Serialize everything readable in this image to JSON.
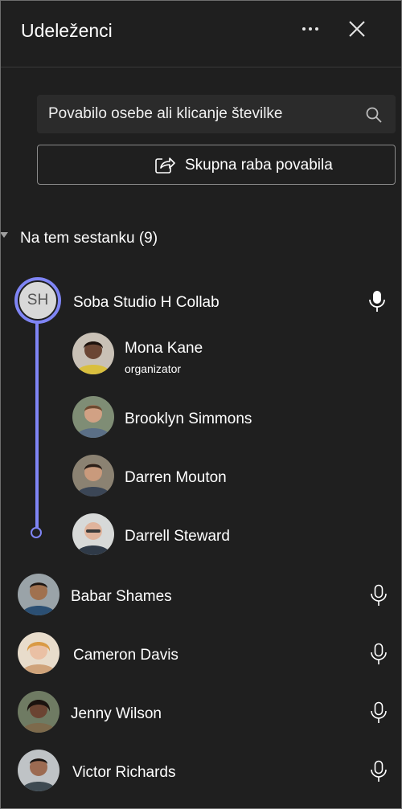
{
  "header": {
    "title": "Udeleženci"
  },
  "search": {
    "placeholder": "Povabilo osebe ali klicanje številke"
  },
  "share": {
    "label": "Skupna raba povabila"
  },
  "section": {
    "title": "Na tem sestanku (9)"
  },
  "group": {
    "name": "Soba Studio H Collab",
    "initials": "SH",
    "members": [
      {
        "name": "Mona  Kane",
        "role": "organizator"
      },
      {
        "name": "Brooklyn Simmons"
      },
      {
        "name": "Darren Mouton"
      },
      {
        "name": "Darrell Steward"
      }
    ]
  },
  "participants": [
    {
      "name": "Babar Shames"
    },
    {
      "name": "Cameron Davis"
    },
    {
      "name": "Jenny Wilson"
    },
    {
      "name": "Victor Richards"
    }
  ],
  "colors": {
    "background": "#1f1f1f",
    "accent": "#7f85f5",
    "search_bg": "#2b2b2b"
  },
  "icons": [
    "more-icon",
    "close-icon",
    "search-icon",
    "share-icon",
    "microphone-icon"
  ]
}
